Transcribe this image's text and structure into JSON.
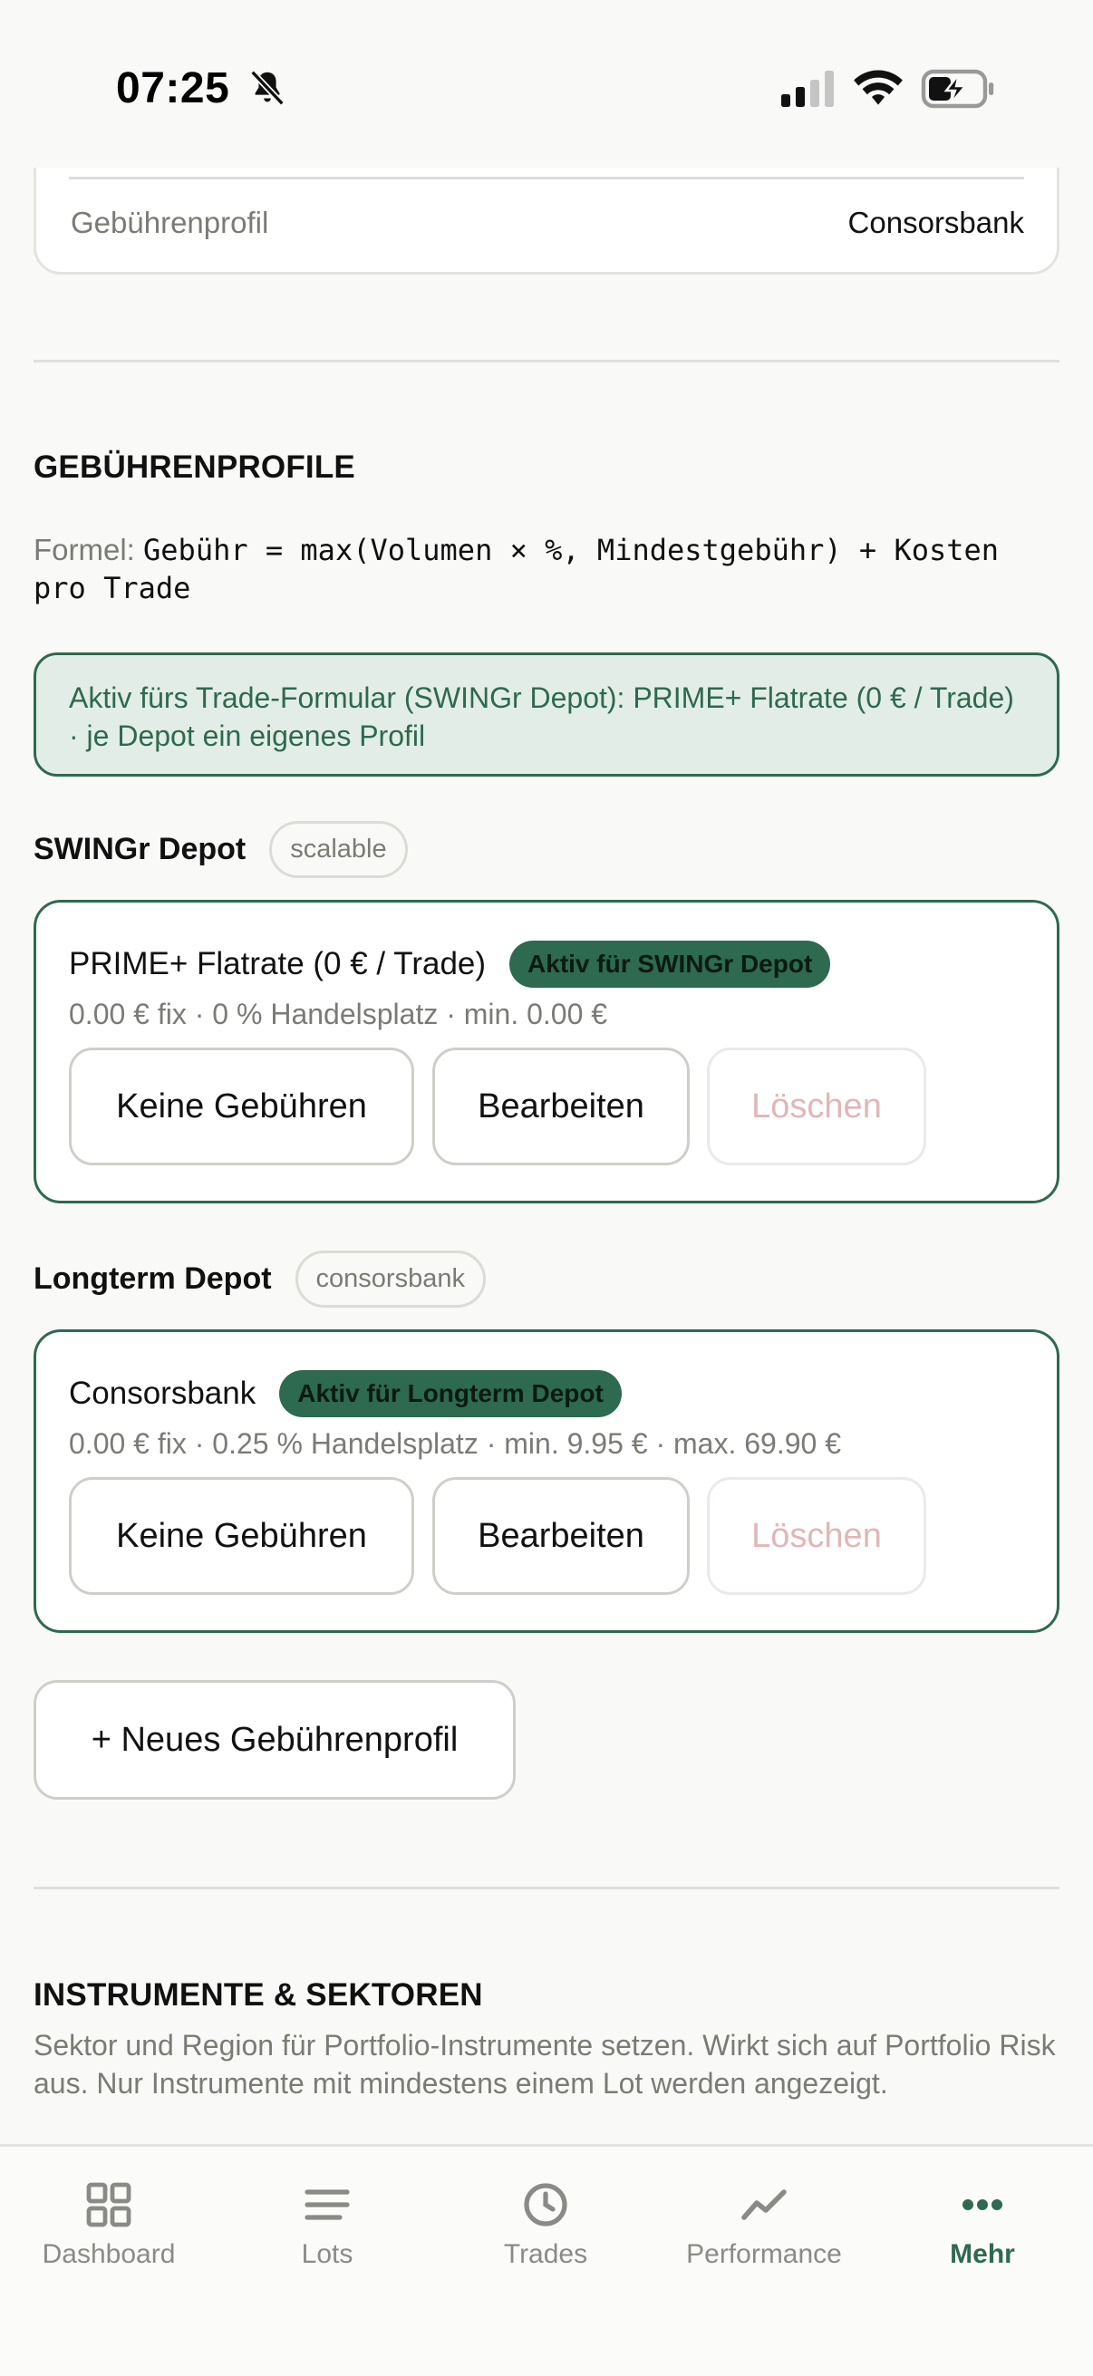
{
  "status_bar": {
    "time": "07:25"
  },
  "top_card": {
    "label": "Gebührenprofil",
    "value": "Consorsbank"
  },
  "fees_section": {
    "title": "GEBÜHRENPROFILE",
    "formula_label": "Formel:",
    "formula_text": "Gebühr = max(Volumen × %, Mindestgebühr) + Kosten pro Trade",
    "info_text": "Aktiv fürs Trade-Formular (SWINGr Depot): PRIME+ Flatrate (0 € / Trade) · je Depot ein eigenes Profil"
  },
  "depots": [
    {
      "name": "SWINGr Depot",
      "tag": "scalable",
      "profile": {
        "name": "PRIME+ Flatrate (0 € / Trade)",
        "badge": "Aktiv für SWINGr Depot",
        "meta": "0.00 € fix · 0 % Handelsplatz · min. 0.00 €"
      }
    },
    {
      "name": "Longterm Depot",
      "tag": "consorsbank",
      "profile": {
        "name": "Consorsbank",
        "badge": "Aktiv für Longterm Depot",
        "meta": "0.00 € fix · 0.25 % Handelsplatz · min. 9.95 € · max. 69.90 €"
      }
    }
  ],
  "buttons": {
    "no_fees": "Keine Gebühren",
    "edit": "Bearbeiten",
    "delete": "Löschen"
  },
  "new_profile_label": "+ Neues Gebührenprofil",
  "instruments_section": {
    "title": "INSTRUMENTE & SEKTOREN",
    "description": "Sektor und Region für Portfolio-Instrumente setzen. Wirkt sich auf Portfolio Risk aus. Nur Instrumente mit mindestens einem Lot werden angezeigt."
  },
  "tabbar": {
    "items": [
      {
        "label": "Dashboard",
        "icon": "grid-icon"
      },
      {
        "label": "Lots",
        "icon": "list-icon"
      },
      {
        "label": "Trades",
        "icon": "clock-icon"
      },
      {
        "label": "Performance",
        "icon": "trend-icon"
      },
      {
        "label": "Mehr",
        "icon": "more-dots-icon",
        "active": true
      }
    ]
  },
  "colors": {
    "accent": "#2d6a4f",
    "accent_bg": "#e3ede7",
    "muted": "#7b7b76",
    "delete_disabled": "#e2b6b6"
  }
}
